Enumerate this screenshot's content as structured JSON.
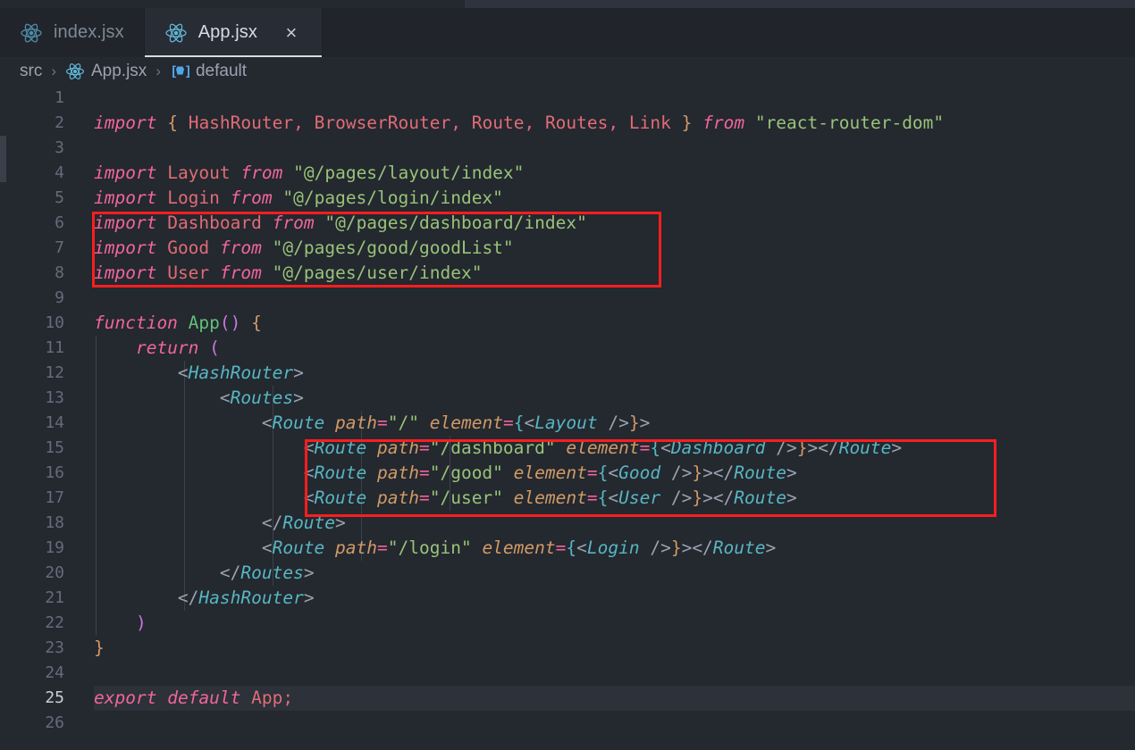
{
  "window": {
    "theme_bg": "#24282f",
    "tabbar_bg": "#21252b",
    "accent": "#4fa6e8",
    "annotation_color": "#fa1e1e"
  },
  "tabs": [
    {
      "label": "index.jsx",
      "icon": "react-icon",
      "active": false,
      "closable": false
    },
    {
      "label": "App.jsx",
      "icon": "react-icon",
      "active": true,
      "closable": true,
      "close_label": "×"
    }
  ],
  "breadcrumb": {
    "items": [
      {
        "label": "src",
        "icon": null
      },
      {
        "label": "App.jsx",
        "icon": "react-icon"
      },
      {
        "label": "default",
        "icon": "symbol-object-icon"
      }
    ],
    "separator": "›"
  },
  "editor": {
    "language": "jsx",
    "active_line": 25,
    "first_line": 1,
    "last_line": 26,
    "lines": [
      {
        "n": 1,
        "text": ""
      },
      {
        "n": 2,
        "text": "import { HashRouter, BrowserRouter, Route, Routes, Link } from \"react-router-dom\""
      },
      {
        "n": 3,
        "text": ""
      },
      {
        "n": 4,
        "text": "import Layout from \"@/pages/layout/index\""
      },
      {
        "n": 5,
        "text": "import Login from \"@/pages/login/index\""
      },
      {
        "n": 6,
        "text": "import Dashboard from \"@/pages/dashboard/index\""
      },
      {
        "n": 7,
        "text": "import Good from \"@/pages/good/goodList\""
      },
      {
        "n": 8,
        "text": "import User from \"@/pages/user/index\""
      },
      {
        "n": 9,
        "text": ""
      },
      {
        "n": 10,
        "text": "function App() {"
      },
      {
        "n": 11,
        "text": "    return ("
      },
      {
        "n": 12,
        "text": "        <HashRouter>"
      },
      {
        "n": 13,
        "text": "            <Routes>"
      },
      {
        "n": 14,
        "text": "                <Route path=\"/\" element={<Layout />}>"
      },
      {
        "n": 15,
        "text": "                    <Route path=\"/dashboard\" element={<Dashboard />}></Route>"
      },
      {
        "n": 16,
        "text": "                    <Route path=\"/good\" element={<Good />}></Route>"
      },
      {
        "n": 17,
        "text": "                    <Route path=\"/user\" element={<User />}></Route>"
      },
      {
        "n": 18,
        "text": "                </Route>"
      },
      {
        "n": 19,
        "text": "                <Route path=\"/login\" element={<Login />}></Route>"
      },
      {
        "n": 20,
        "text": "            </Routes>"
      },
      {
        "n": 21,
        "text": "        </HashRouter>"
      },
      {
        "n": 22,
        "text": "    )"
      },
      {
        "n": 23,
        "text": "}"
      },
      {
        "n": 24,
        "text": ""
      },
      {
        "n": 25,
        "text": "export default App;"
      },
      {
        "n": 26,
        "text": ""
      }
    ]
  },
  "annotations": [
    {
      "name": "imports-highlight",
      "lines": "6-8",
      "label": ""
    },
    {
      "name": "routes-highlight",
      "lines": "15-17",
      "label": ""
    }
  ]
}
